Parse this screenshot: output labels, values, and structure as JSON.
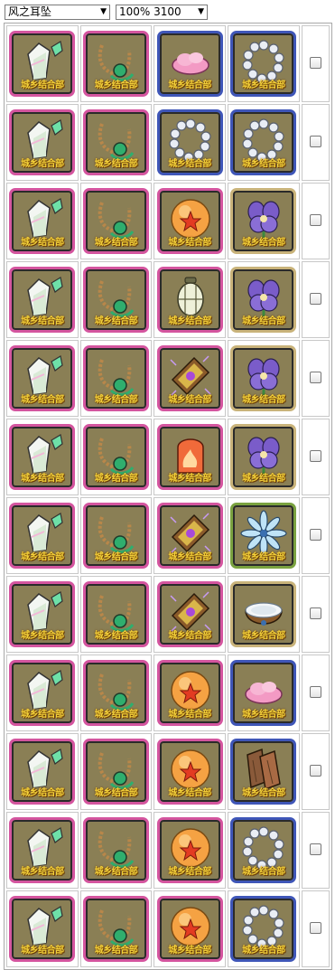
{
  "controls": {
    "item_select": "风之耳坠",
    "rate_select": "100% 3100"
  },
  "watermark": "城乡结合部",
  "rows": [
    [
      {
        "item": "crystal",
        "frame": "pink"
      },
      {
        "item": "necklace",
        "frame": "pink"
      },
      {
        "item": "pink-cloud",
        "frame": "blue"
      },
      {
        "item": "pearl-ring",
        "frame": "blue"
      }
    ],
    [
      {
        "item": "crystal",
        "frame": "pink"
      },
      {
        "item": "necklace",
        "frame": "pink"
      },
      {
        "item": "pearl-ring",
        "frame": "blue"
      },
      {
        "item": "pearl-ring",
        "frame": "blue"
      }
    ],
    [
      {
        "item": "crystal",
        "frame": "pink"
      },
      {
        "item": "necklace",
        "frame": "pink"
      },
      {
        "item": "star-orb",
        "frame": "pink"
      },
      {
        "item": "violet-flower",
        "frame": "tan"
      }
    ],
    [
      {
        "item": "crystal",
        "frame": "pink"
      },
      {
        "item": "necklace",
        "frame": "pink"
      },
      {
        "item": "lantern",
        "frame": "pink"
      },
      {
        "item": "violet-flower",
        "frame": "tan"
      }
    ],
    [
      {
        "item": "crystal",
        "frame": "pink"
      },
      {
        "item": "necklace",
        "frame": "pink"
      },
      {
        "item": "spellbook",
        "frame": "pink"
      },
      {
        "item": "violet-flower",
        "frame": "tan"
      }
    ],
    [
      {
        "item": "crystal",
        "frame": "pink"
      },
      {
        "item": "necklace",
        "frame": "pink"
      },
      {
        "item": "fire-stone",
        "frame": "pink"
      },
      {
        "item": "violet-flower",
        "frame": "tan"
      }
    ],
    [
      {
        "item": "crystal",
        "frame": "pink"
      },
      {
        "item": "necklace",
        "frame": "pink"
      },
      {
        "item": "spellbook",
        "frame": "pink"
      },
      {
        "item": "ice-flower",
        "frame": "green"
      }
    ],
    [
      {
        "item": "crystal",
        "frame": "pink"
      },
      {
        "item": "necklace",
        "frame": "pink"
      },
      {
        "item": "spellbook",
        "frame": "pink"
      },
      {
        "item": "coconut",
        "frame": "tan"
      }
    ],
    [
      {
        "item": "crystal",
        "frame": "pink"
      },
      {
        "item": "necklace",
        "frame": "pink"
      },
      {
        "item": "star-orb",
        "frame": "pink"
      },
      {
        "item": "pink-cloud",
        "frame": "blue"
      }
    ],
    [
      {
        "item": "crystal",
        "frame": "pink"
      },
      {
        "item": "necklace",
        "frame": "pink"
      },
      {
        "item": "star-orb",
        "frame": "pink"
      },
      {
        "item": "wood-planks",
        "frame": "blue"
      }
    ],
    [
      {
        "item": "crystal",
        "frame": "pink"
      },
      {
        "item": "necklace",
        "frame": "pink"
      },
      {
        "item": "star-orb",
        "frame": "pink"
      },
      {
        "item": "pearl-ring",
        "frame": "blue"
      }
    ],
    [
      {
        "item": "crystal",
        "frame": "pink"
      },
      {
        "item": "necklace",
        "frame": "pink"
      },
      {
        "item": "star-orb",
        "frame": "pink"
      },
      {
        "item": "pearl-ring",
        "frame": "blue"
      }
    ]
  ]
}
